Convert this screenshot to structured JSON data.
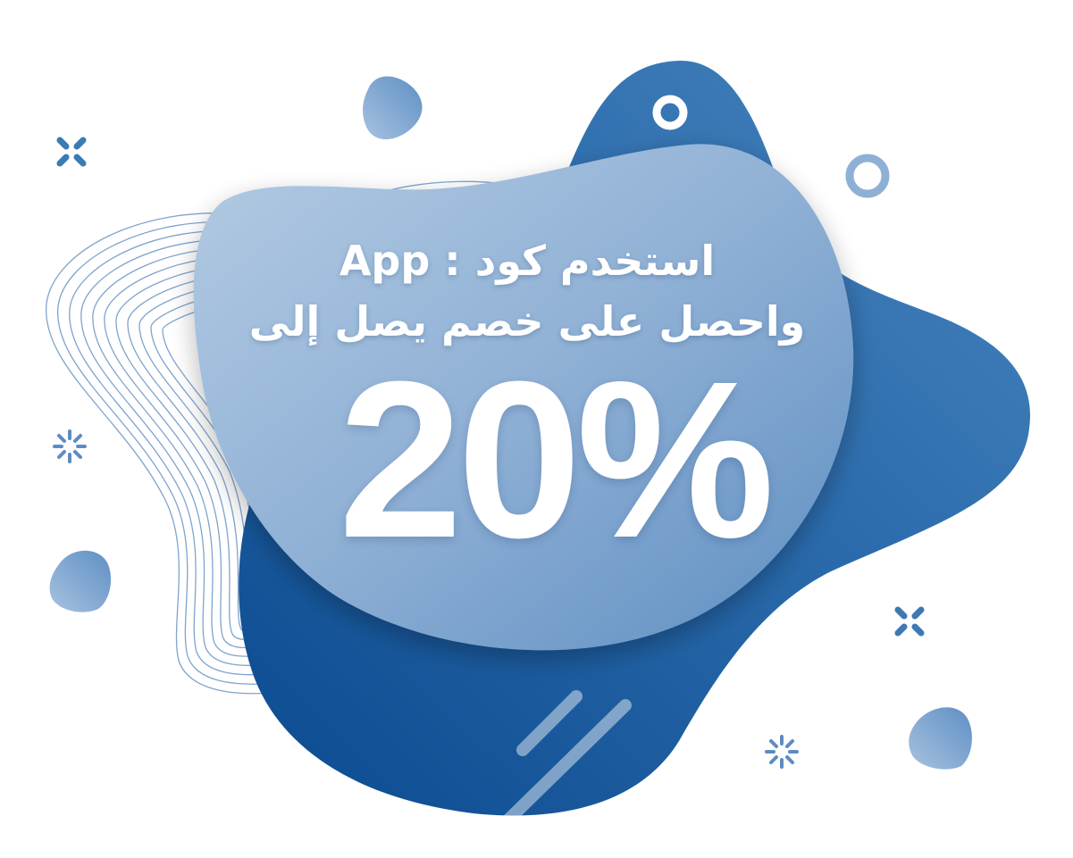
{
  "promo": {
    "line1": "استخدم كود : App",
    "line2": "واحصل على خصم يصل إلى",
    "discount": "20%"
  },
  "colors": {
    "dark_blue": "#0d4f94",
    "mid_blue": "#3d79b4",
    "light_blue": "#a9c4e0",
    "accent": "#5d8cc4",
    "white": "#ffffff"
  },
  "decorations": {
    "cross_icon": "cross-sparkle-icon",
    "ring_icon": "ring-icon",
    "burst_icon": "burst-icon",
    "pebble_icon": "pebble-blob-icon",
    "stripe_icon": "diagonal-stripe-icon",
    "contour_icon": "contour-lines-icon"
  }
}
